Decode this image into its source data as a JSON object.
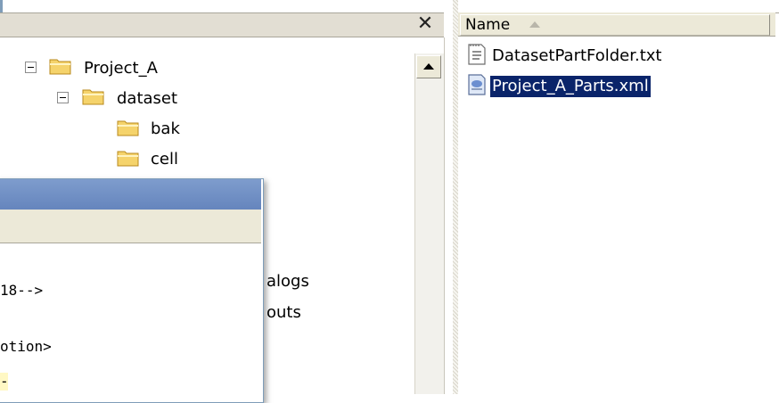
{
  "tree_pane": {
    "close_glyph": "✕",
    "items": [
      {
        "label": "Project_A",
        "expanded": true,
        "icon": "folder-open-icon"
      },
      {
        "label": "dataset",
        "expanded": true,
        "icon": "folder-open-icon"
      },
      {
        "label": "bak",
        "icon": "folder-icon"
      },
      {
        "label": "cell",
        "icon": "folder-icon"
      }
    ],
    "partial_items": [
      "alogs",
      "outs"
    ]
  },
  "list_pane": {
    "column_header": "Name",
    "sort": "ascending",
    "files": [
      {
        "name": "DatasetPartFolder.txt",
        "icon": "text-file-icon",
        "selected": false
      },
      {
        "name": "Project_A_Parts.xml",
        "icon": "xml-file-icon",
        "selected": true
      }
    ]
  },
  "dialog": {
    "code_lines": [
      "18-->",
      "otion>",
      "-"
    ]
  },
  "colors": {
    "selection": "#0a246a",
    "folder": "#f5d36b",
    "dialog_title": "#6f8ec4",
    "chrome": "#ece9d8"
  }
}
